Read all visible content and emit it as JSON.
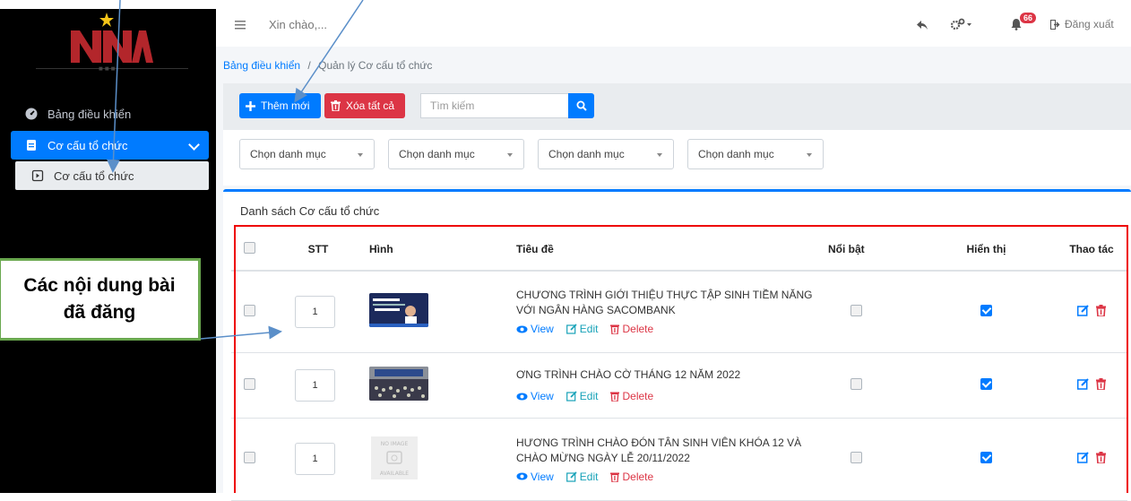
{
  "sidebar": {
    "items": [
      {
        "label": "Bảng điều khiển"
      },
      {
        "label": "Cơ cấu tổ chức"
      },
      {
        "label": "Cơ cấu tổ chức"
      }
    ]
  },
  "topbar": {
    "greeting": "Xin chào,...",
    "bell_count": "66",
    "logout": "Đăng xuất"
  },
  "breadcrumb": {
    "home": "Bảng điều khiển",
    "sep": "/",
    "current": "Quản lý Cơ cấu tổ chức"
  },
  "toolbar": {
    "add_label": "Thêm mới",
    "delete_all_label": "Xóa tất cả",
    "search_placeholder": "Tìm kiếm"
  },
  "filters": [
    "Chọn danh mục",
    "Chọn danh mục",
    "Chọn danh mục",
    "Chọn danh mục"
  ],
  "card": {
    "title": "Danh sách Cơ cấu tổ chức"
  },
  "table": {
    "headers": {
      "stt": "STT",
      "image": "Hình",
      "title": "Tiêu đề",
      "featured": "Nổi bật",
      "visible": "Hiển thị",
      "actions": "Thao tác"
    },
    "rows": [
      {
        "stt": "1",
        "title": "CHƯƠNG TRÌNH GIỚI THIỆU THỰC TẬP SINH TIỀM NĂNG VỚI NGÂN HÀNG SACOMBANK",
        "featured": false,
        "visible": true,
        "image": "banner"
      },
      {
        "stt": "1",
        "title": "ƠNG TRÌNH CHÀO CỜ THÁNG 12 NĂM 2022",
        "featured": false,
        "visible": true,
        "image": "photo"
      },
      {
        "stt": "1",
        "title": "HƯƠNG TRÌNH CHÀO ĐÓN TÂN SINH VIÊN KHÓA 12 VÀ CHÀO MỪNG NGÀY LỄ 20/11/2022",
        "featured": false,
        "visible": true,
        "image": "no-image"
      }
    ],
    "row_links": {
      "view": "View",
      "edit": "Edit",
      "delete": "Delete"
    }
  },
  "callout": {
    "line1": "Các nội dung bài",
    "line2": "đã đăng"
  },
  "colors": {
    "primary": "#007bff",
    "danger": "#dc3545",
    "sidebar": "#000000",
    "callout_border": "#6aa84f",
    "highlight_frame": "#ee0000"
  }
}
